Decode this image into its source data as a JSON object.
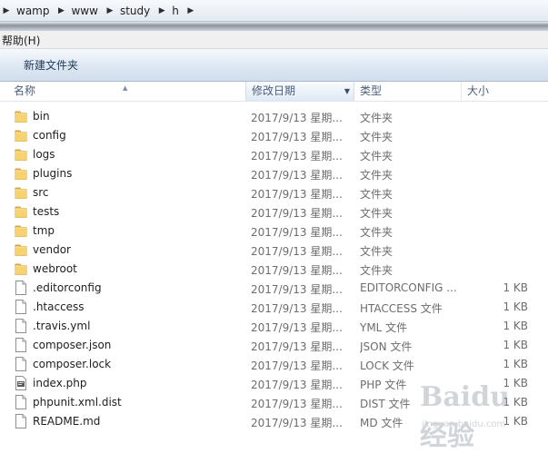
{
  "breadcrumb": [
    "wamp",
    "www",
    "study",
    "h"
  ],
  "menu": {
    "help": "帮助(H)"
  },
  "toolbar": {
    "new_folder": "新建文件夹"
  },
  "columns": {
    "name": "名称",
    "date": "修改日期",
    "type": "类型",
    "size": "大小"
  },
  "files": [
    {
      "name": "bin",
      "date": "2017/9/13 星期...",
      "type": "文件夹",
      "size": "",
      "kind": "folder"
    },
    {
      "name": "config",
      "date": "2017/9/13 星期...",
      "type": "文件夹",
      "size": "",
      "kind": "folder"
    },
    {
      "name": "logs",
      "date": "2017/9/13 星期...",
      "type": "文件夹",
      "size": "",
      "kind": "folder"
    },
    {
      "name": "plugins",
      "date": "2017/9/13 星期...",
      "type": "文件夹",
      "size": "",
      "kind": "folder"
    },
    {
      "name": "src",
      "date": "2017/9/13 星期...",
      "type": "文件夹",
      "size": "",
      "kind": "folder"
    },
    {
      "name": "tests",
      "date": "2017/9/13 星期...",
      "type": "文件夹",
      "size": "",
      "kind": "folder"
    },
    {
      "name": "tmp",
      "date": "2017/9/13 星期...",
      "type": "文件夹",
      "size": "",
      "kind": "folder"
    },
    {
      "name": "vendor",
      "date": "2017/9/13 星期...",
      "type": "文件夹",
      "size": "",
      "kind": "folder"
    },
    {
      "name": "webroot",
      "date": "2017/9/13 星期...",
      "type": "文件夹",
      "size": "",
      "kind": "folder"
    },
    {
      "name": ".editorconfig",
      "date": "2017/9/13 星期...",
      "type": "EDITORCONFIG ...",
      "size": "1 KB",
      "kind": "file"
    },
    {
      "name": ".htaccess",
      "date": "2017/9/13 星期...",
      "type": "HTACCESS 文件",
      "size": "1 KB",
      "kind": "file"
    },
    {
      "name": ".travis.yml",
      "date": "2017/9/13 星期...",
      "type": "YML 文件",
      "size": "1 KB",
      "kind": "file"
    },
    {
      "name": "composer.json",
      "date": "2017/9/13 星期...",
      "type": "JSON 文件",
      "size": "1 KB",
      "kind": "file"
    },
    {
      "name": "composer.lock",
      "date": "2017/9/13 星期...",
      "type": "LOCK 文件",
      "size": "1 KB",
      "kind": "file"
    },
    {
      "name": "index.php",
      "date": "2017/9/13 星期...",
      "type": "PHP 文件",
      "size": "1 KB",
      "kind": "php"
    },
    {
      "name": "phpunit.xml.dist",
      "date": "2017/9/13 星期...",
      "type": "DIST 文件",
      "size": "1 KB",
      "kind": "file"
    },
    {
      "name": "README.md",
      "date": "2017/9/13 星期...",
      "type": "MD 文件",
      "size": "1 KB",
      "kind": "file"
    }
  ],
  "watermark": {
    "brand": "Baidu 经验",
    "url": "jingyan.baidu.com"
  }
}
